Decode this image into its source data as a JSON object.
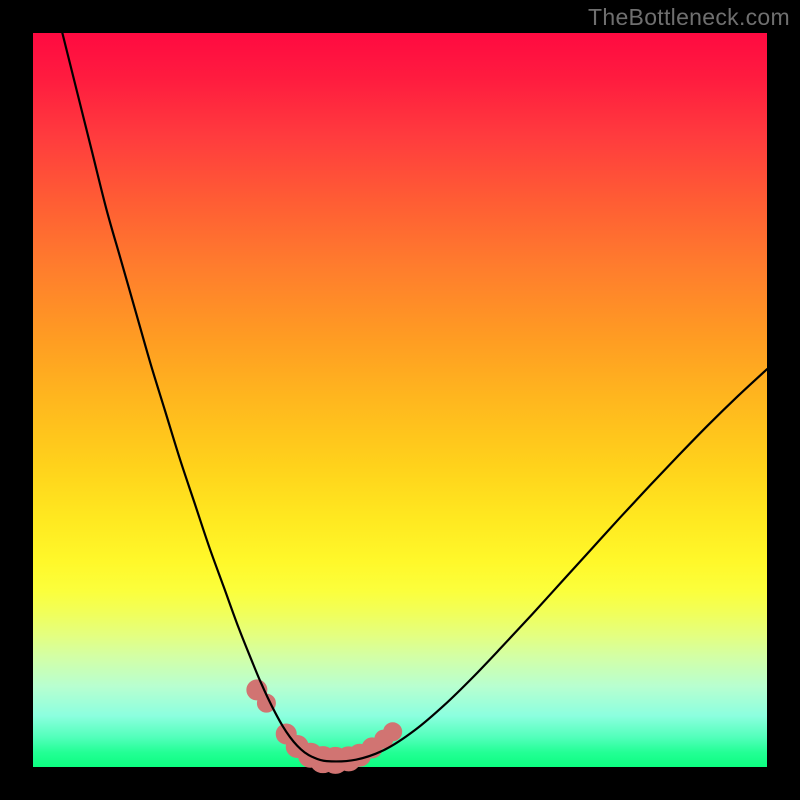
{
  "watermark": "TheBottleneck.com",
  "colors": {
    "frame": "#000000",
    "curve": "#000000",
    "marker": "#d17472",
    "gradient_top": "#ff0a41",
    "gradient_bottom": "#0cfe80"
  },
  "chart_data": {
    "type": "line",
    "title": "",
    "xlabel": "",
    "ylabel": "",
    "xlim": [
      0,
      100
    ],
    "ylim": [
      0,
      100
    ],
    "grid": false,
    "series": [
      {
        "name": "bottleneck-curve",
        "x": [
          4,
          6,
          8,
          10,
          12,
          14,
          16,
          18,
          20,
          22,
          24,
          26,
          28,
          30,
          31,
          32,
          33,
          34,
          35,
          36,
          37,
          38,
          40,
          44,
          48,
          52,
          56,
          60,
          64,
          68,
          72,
          76,
          80,
          84,
          88,
          92,
          96,
          100
        ],
        "y": [
          100,
          92,
          84,
          76,
          69,
          62,
          55,
          48.5,
          42,
          36,
          30,
          24.5,
          19,
          14,
          11.6,
          9.4,
          7.4,
          5.6,
          4.1,
          2.9,
          2.0,
          1.4,
          0.8,
          1.0,
          2.4,
          5.0,
          8.4,
          12.3,
          16.5,
          20.8,
          25.2,
          29.6,
          34.0,
          38.3,
          42.5,
          46.6,
          50.5,
          54.2
        ]
      }
    ],
    "markers": {
      "name": "highlight-dots",
      "x": [
        30.5,
        31.8,
        34.5,
        36.0,
        37.8,
        39.5,
        41.2,
        43.0,
        44.5,
        46.2,
        47.8,
        49.0
      ],
      "y": [
        10.5,
        8.7,
        4.5,
        2.8,
        1.6,
        1.0,
        0.9,
        1.1,
        1.6,
        2.6,
        3.8,
        4.8
      ],
      "r": [
        10,
        9,
        10,
        11,
        12,
        13,
        13,
        12,
        11,
        10,
        9,
        9
      ]
    }
  }
}
